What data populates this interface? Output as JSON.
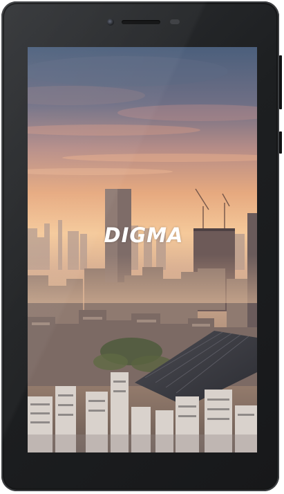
{
  "device": {
    "type": "tablet",
    "bezel_color": "#1f2123"
  },
  "screen": {
    "wallpaper": "city-skyline-at-sunset",
    "logo_text": "DIGMA",
    "sky_colors": [
      "#4b5f7c",
      "#8d7f86",
      "#e2a37a",
      "#f4c595"
    ]
  },
  "icons": [
    "front-camera-icon",
    "earpiece-speaker-icon",
    "light-sensor-icon"
  ]
}
